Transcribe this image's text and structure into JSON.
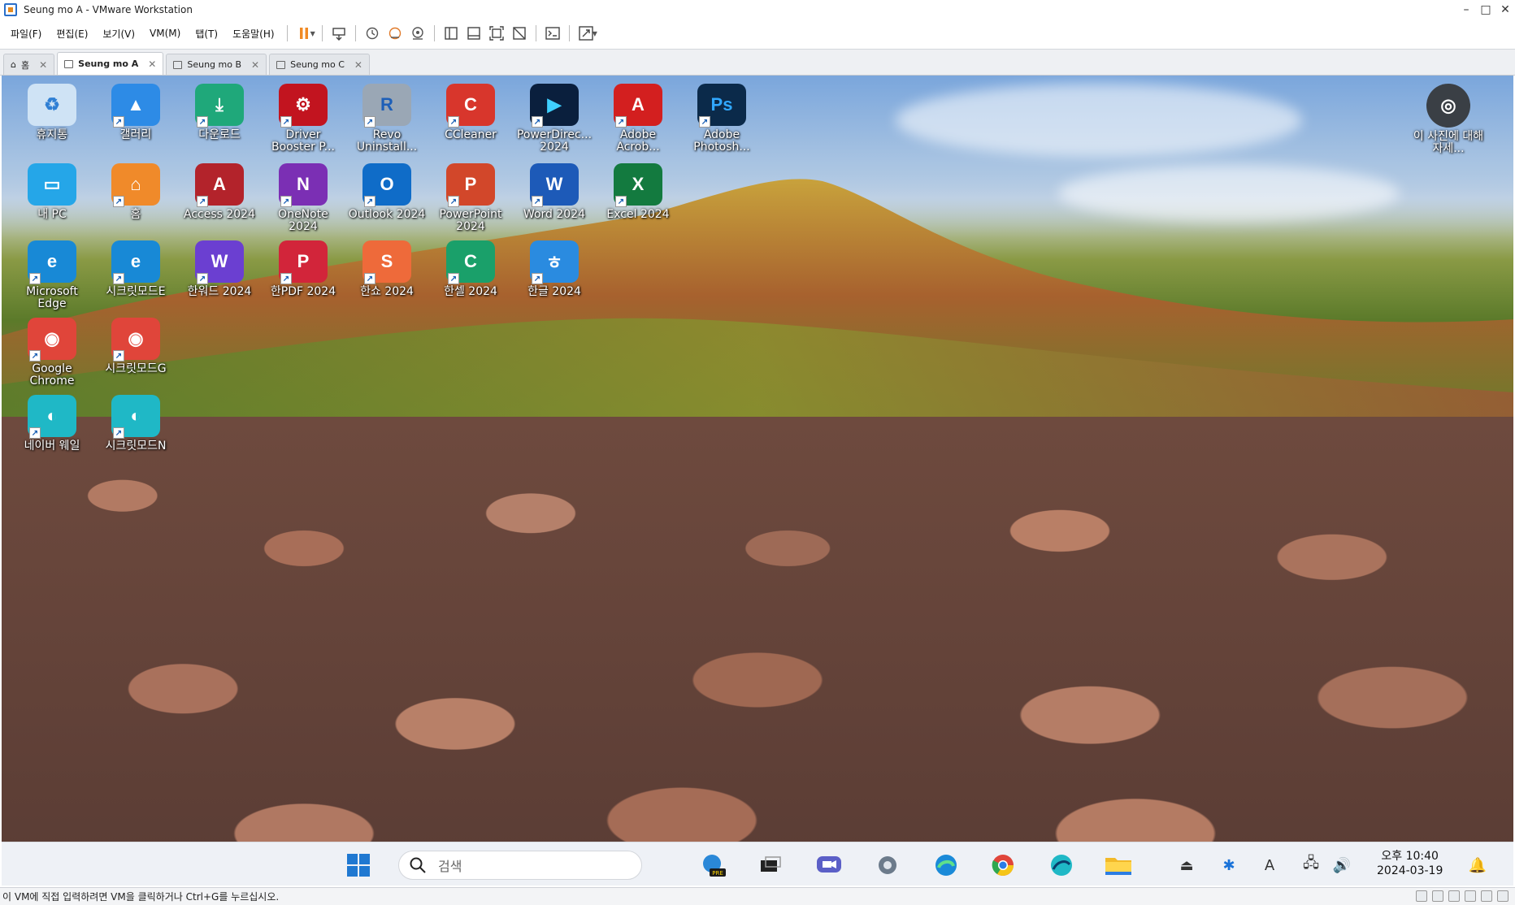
{
  "window": {
    "title": "Seung mo A - VMware Workstation",
    "min": "–",
    "max": "□",
    "close": "✕"
  },
  "menu": [
    "파일(F)",
    "편집(E)",
    "보기(V)",
    "VM(M)",
    "탭(T)",
    "도움말(H)"
  ],
  "tabs": [
    {
      "label": "홈",
      "active": false
    },
    {
      "label": "Seung mo A",
      "active": true
    },
    {
      "label": "Seung mo B",
      "active": false
    },
    {
      "label": "Seung mo C",
      "active": false
    }
  ],
  "desktop": {
    "icons": [
      {
        "label": "휴지통",
        "color": "#cfe3f5",
        "glyph": "♻",
        "fg": "#2f7fd4"
      },
      {
        "label": "갤러리",
        "color": "#2d8be6",
        "glyph": "▲",
        "fg": "#fff"
      },
      {
        "label": "다운로드",
        "color": "#1fa87a",
        "glyph": "⤓",
        "fg": "#fff"
      },
      {
        "label": "Driver Booster P...",
        "color": "#c2141f",
        "glyph": "⚙",
        "fg": "#fff"
      },
      {
        "label": "Revo Uninstall...",
        "color": "#9aa7b5",
        "glyph": "R",
        "fg": "#1d5fb8"
      },
      {
        "label": "CCleaner",
        "color": "#d8362c",
        "glyph": "C",
        "fg": "#fff"
      },
      {
        "label": "PowerDirec... 2024",
        "color": "#0a1f3d",
        "glyph": "▶",
        "fg": "#3fd0ff"
      },
      {
        "label": "Adobe Acrob...",
        "color": "#d31f1f",
        "glyph": "A",
        "fg": "#fff"
      },
      {
        "label": "Adobe Photosh...",
        "color": "#0b2a4a",
        "glyph": "Ps",
        "fg": "#31a8ff"
      },
      {
        "label": "내 PC",
        "color": "#25a6e8",
        "glyph": "▭",
        "fg": "#fff"
      },
      {
        "label": "홈",
        "color": "#f08a2a",
        "glyph": "⌂",
        "fg": "#fff"
      },
      {
        "label": "Access 2024",
        "color": "#b3232b",
        "glyph": "A",
        "fg": "#fff"
      },
      {
        "label": "OneNote 2024",
        "color": "#7b2fb4",
        "glyph": "N",
        "fg": "#fff"
      },
      {
        "label": "Outlook 2024",
        "color": "#0f6cc8",
        "glyph": "O",
        "fg": "#fff"
      },
      {
        "label": "PowerPoint 2024",
        "color": "#d2472a",
        "glyph": "P",
        "fg": "#fff"
      },
      {
        "label": "Word 2024",
        "color": "#1d5ab8",
        "glyph": "W",
        "fg": "#fff"
      },
      {
        "label": "Excel 2024",
        "color": "#137a3f",
        "glyph": "X",
        "fg": "#fff"
      },
      {
        "label": "Microsoft Edge",
        "color": "#1889d6",
        "glyph": "e",
        "fg": "#fff"
      },
      {
        "label": "시크릿모드E",
        "color": "#1889d6",
        "glyph": "e",
        "fg": "#fff"
      },
      {
        "label": "한워드 2024",
        "color": "#6b3fd1",
        "glyph": "W",
        "fg": "#fff"
      },
      {
        "label": "한PDF 2024",
        "color": "#d2253a",
        "glyph": "P",
        "fg": "#fff"
      },
      {
        "label": "한쇼 2024",
        "color": "#ee6a3a",
        "glyph": "S",
        "fg": "#fff"
      },
      {
        "label": "한셀 2024",
        "color": "#1aa06a",
        "glyph": "C",
        "fg": "#fff"
      },
      {
        "label": "한글 2024",
        "color": "#2a8be0",
        "glyph": "ㅎ",
        "fg": "#fff"
      },
      {
        "label": "Google Chrome",
        "color": "#e0453a",
        "glyph": "◉",
        "fg": "#fff"
      },
      {
        "label": "시크릿모드G",
        "color": "#e0453a",
        "glyph": "◉",
        "fg": "#fff"
      },
      {
        "label": "네이버 웨일",
        "color": "#1fb8c6",
        "glyph": "◐",
        "fg": "#fff"
      },
      {
        "label": "시크릿모드N",
        "color": "#1fb8c6",
        "glyph": "◐",
        "fg": "#fff"
      }
    ],
    "photo_info": {
      "label": "이 사진에 대해 자세..."
    }
  },
  "taskbar": {
    "search_placeholder": "검색",
    "time": "오후 10:40",
    "date": "2024-03-19",
    "apps": [
      "copilot-pre",
      "task-view",
      "meet",
      "settings",
      "edge",
      "chrome",
      "whale",
      "file-explorer"
    ],
    "tray_lang": "A"
  },
  "status": {
    "text": "이 VM에 직접 입력하려면 VM을 클릭하거나 Ctrl+G를 누르십시오."
  }
}
